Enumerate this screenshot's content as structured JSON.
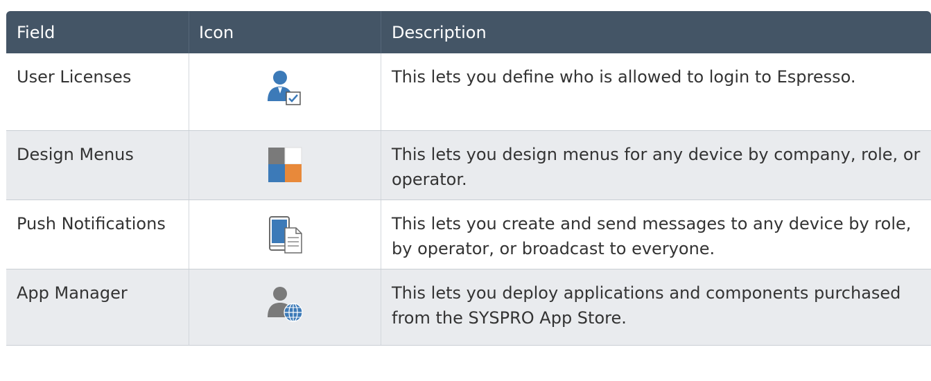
{
  "table": {
    "headers": {
      "field": "Field",
      "icon": "Icon",
      "description": "Description"
    },
    "rows": [
      {
        "field": "User Licenses",
        "icon": "user-check-icon",
        "description": "This lets you define who is allowed to login to Espresso."
      },
      {
        "field": "Design Menus",
        "icon": "tile-grid-icon",
        "description": "This lets you design menus for any device by company, role, or operator."
      },
      {
        "field": "Push Notifications",
        "icon": "mobile-document-icon",
        "description": "This lets you create and send messages to any device by role, by operator, or broadcast to everyone."
      },
      {
        "field": "App Manager",
        "icon": "user-globe-icon",
        "description": "This lets you deploy applications and components purchased from the SYSPRO App Store."
      }
    ]
  },
  "colors": {
    "header_bg": "#445566",
    "row_alt_bg": "#e9ebee",
    "icon_blue": "#3c7ab8",
    "icon_orange": "#e8893a",
    "icon_gray": "#7a7a7a"
  }
}
